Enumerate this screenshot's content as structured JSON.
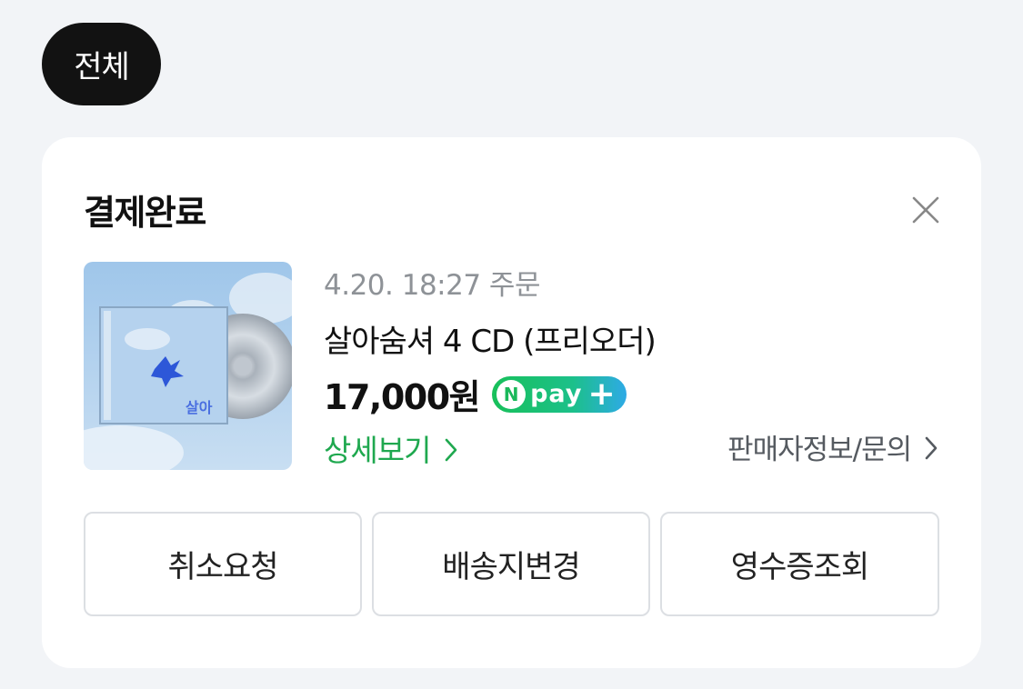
{
  "filter": {
    "label": "전체"
  },
  "order": {
    "status": "결제완료",
    "meta": "4.20. 18:27 주문",
    "title": "살아숨셔 4 CD (프리오더)",
    "price": "17,000원",
    "badge": {
      "n": "N",
      "text": "pay",
      "plus": "+"
    },
    "detail_link": "상세보기",
    "seller_link": "판매자정보/문의",
    "actions": [
      "취소요청",
      "배송지변경",
      "영수증조회"
    ]
  },
  "colors": {
    "accent_green": "#1fa84f",
    "chip_bg": "#121212",
    "page_bg": "#f2f4f7"
  },
  "icons": [
    "close-icon",
    "chevron-right-icon",
    "npay-plus-badge"
  ]
}
